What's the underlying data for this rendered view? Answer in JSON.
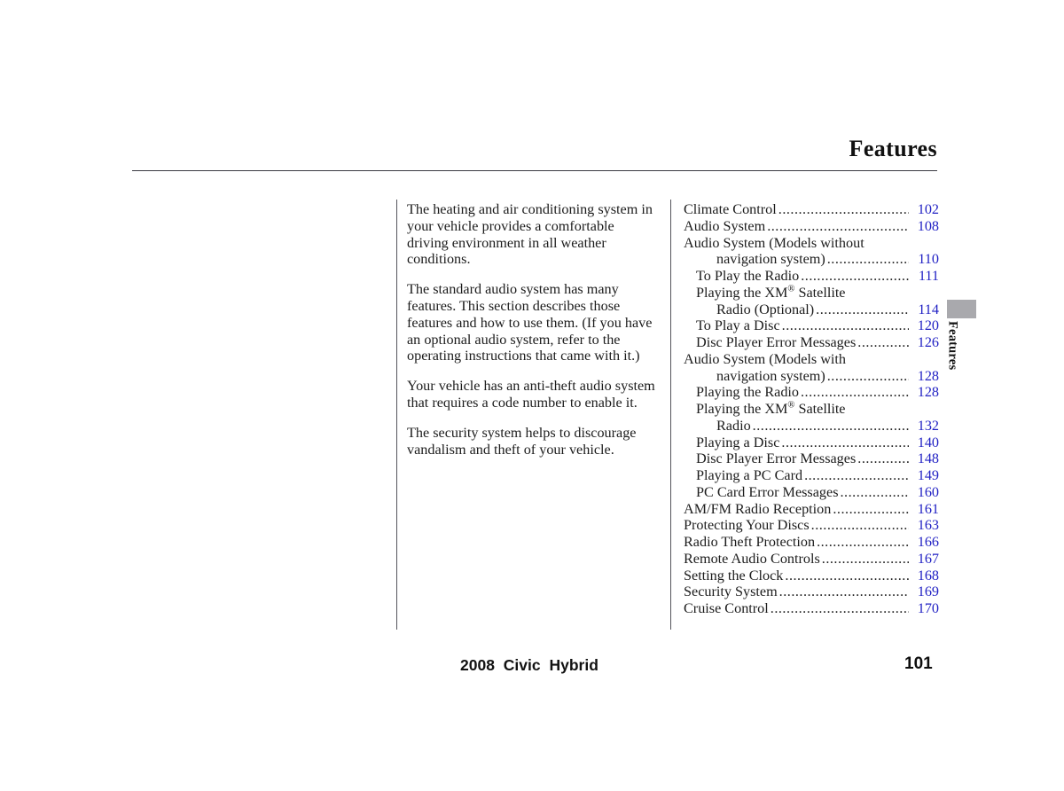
{
  "header": {
    "title": "Features"
  },
  "side_tab": {
    "label": "Features",
    "color": "#a9a9ad"
  },
  "intro_paragraphs": [
    "The heating and air conditioning system in your vehicle provides a comfortable driving environment in all weather conditions.",
    "The standard audio system has many features. This section describes those features and how to use them. (If you have an optional audio system, refer to the operating instructions that came with it.)",
    "Your vehicle has an anti-theft audio system that requires a code number to enable it.",
    "The security system helps to discourage vandalism and theft of your vehicle."
  ],
  "toc": {
    "page_number_color": "#2222c4",
    "entries": [
      {
        "label": "Climate Control",
        "page": "102",
        "level": 0,
        "leader": true
      },
      {
        "label": "Audio System ",
        "page": "108",
        "level": 0,
        "leader": true
      },
      {
        "label": "Audio System (Models without",
        "page": "",
        "level": 0,
        "leader": false
      },
      {
        "label": "navigation system) ",
        "page": "110",
        "level": 2,
        "leader": true
      },
      {
        "label": "To Play the Radio ",
        "page": "111",
        "level": 1,
        "leader": true
      },
      {
        "label": "Playing the XM® Satellite",
        "page": "",
        "level": 1,
        "leader": false
      },
      {
        "label": "Radio (Optional) ",
        "page": "114",
        "level": 2,
        "leader": true
      },
      {
        "label": "To Play a Disc ",
        "page": "120",
        "level": 1,
        "leader": true
      },
      {
        "label": "Disc Player Error Messages ",
        "page": "126",
        "level": 1,
        "leader": true
      },
      {
        "label": "Audio System (Models with",
        "page": "",
        "level": 0,
        "leader": false
      },
      {
        "label": "navigation system) ",
        "page": "128",
        "level": 2,
        "leader": true
      },
      {
        "label": "Playing the Radio",
        "page": "128",
        "level": 1,
        "leader": true
      },
      {
        "label": "Playing the XM® Satellite",
        "page": "",
        "level": 1,
        "leader": false
      },
      {
        "label": "Radio ",
        "page": "132",
        "level": 2,
        "leader": true
      },
      {
        "label": "Playing a Disc",
        "page": "140",
        "level": 1,
        "leader": true
      },
      {
        "label": "Disc Player Error Messages ",
        "page": "148",
        "level": 1,
        "leader": true
      },
      {
        "label": "Playing a PC Card",
        "page": "149",
        "level": 1,
        "leader": true
      },
      {
        "label": "PC Card Error Messages ",
        "page": "160",
        "level": 1,
        "leader": true
      },
      {
        "label": "AM/FM Radio Reception",
        "page": "161",
        "level": 0,
        "leader": true
      },
      {
        "label": "Protecting Your Discs",
        "page": "163",
        "level": 0,
        "leader": true
      },
      {
        "label": "Radio Theft Protection",
        "page": "166",
        "level": 0,
        "leader": true
      },
      {
        "label": "Remote Audio Controls",
        "page": "167",
        "level": 0,
        "leader": true
      },
      {
        "label": "Setting the Clock ",
        "page": "168",
        "level": 0,
        "leader": true
      },
      {
        "label": "Security System ",
        "page": "169",
        "level": 0,
        "leader": true
      },
      {
        "label": "Cruise Control",
        "page": "170",
        "level": 0,
        "leader": true
      }
    ]
  },
  "footer": {
    "model": "2008 Civic Hybrid",
    "page_number": "101"
  }
}
